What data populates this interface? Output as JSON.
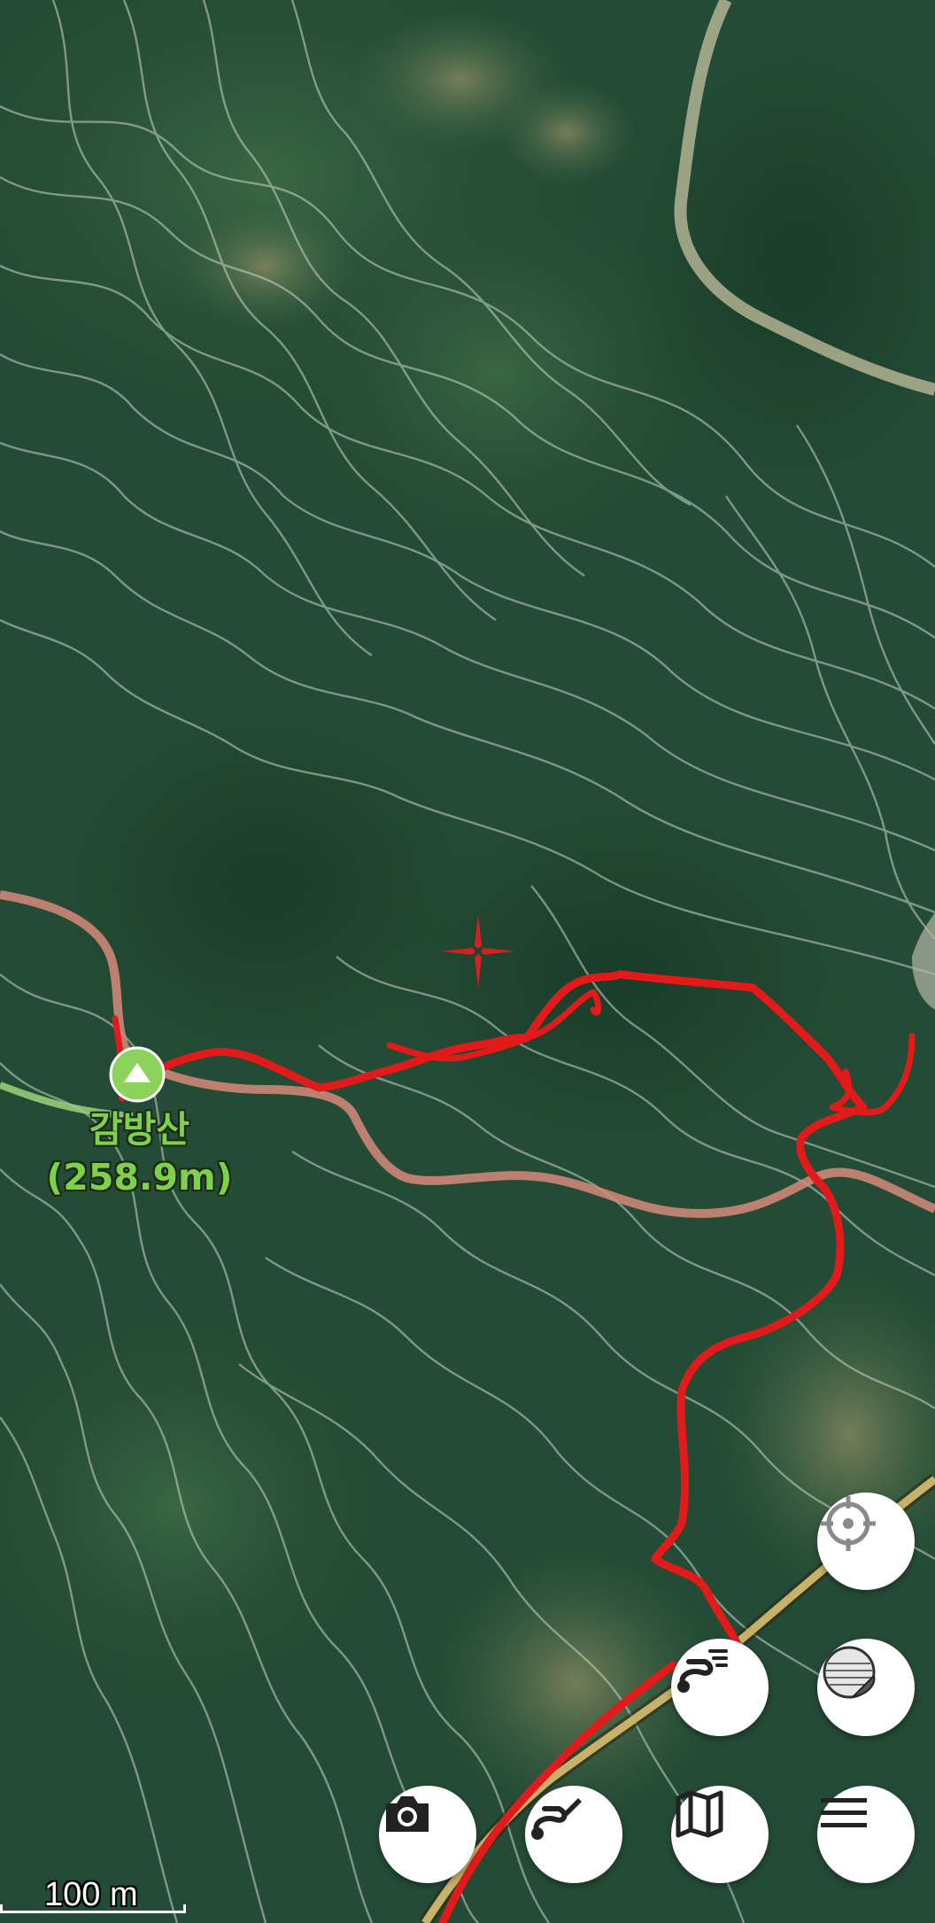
{
  "map": {
    "type": "satellite-topo",
    "colors": {
      "terrain": "#234a34",
      "contour": "#c9d6cc",
      "trail": "#d78a7a",
      "track": "#e31a1a",
      "road": "#c8b26a",
      "peak_marker": "#8bd35a",
      "crosshair": "#d32020"
    }
  },
  "peak": {
    "name": "감방산",
    "elevation": "(258.9m)"
  },
  "scale": {
    "label": "100 m"
  },
  "controls": {
    "locate": {
      "icon": "crosshair-icon"
    },
    "track_list": {
      "icon": "track-list-icon"
    },
    "layers": {
      "icon": "layers-icon"
    },
    "camera": {
      "icon": "camera-icon"
    },
    "route_edit": {
      "icon": "route-edit-icon"
    },
    "map_select": {
      "icon": "map-icon"
    },
    "menu": {
      "icon": "menu-icon"
    }
  }
}
